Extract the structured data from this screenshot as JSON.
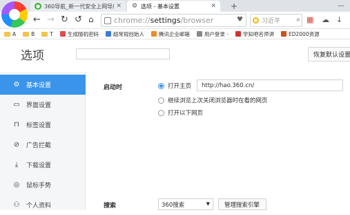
{
  "tabs": [
    {
      "title": "360导航_新一代安全上网导航",
      "active": false
    },
    {
      "title": "选项 - 基本设置",
      "active": true
    }
  ],
  "new_tab_glyph": "+",
  "window_controls": "— ",
  "toolbar": {
    "url_prefix": "chrome://",
    "url_host": "settings",
    "url_path": "/browser",
    "search_placeholder": "习近平"
  },
  "bookmarks": [
    {
      "label": "A",
      "type": "folder"
    },
    {
      "label": "B",
      "type": "folder"
    },
    {
      "label": "T",
      "type": "folder"
    },
    {
      "label": "生成随机密码",
      "type": "link",
      "color": "#e04b4b"
    },
    {
      "label": "超常规创始人",
      "type": "link",
      "color": "#3b7dd8"
    },
    {
      "label": "腾讯企业邮箱",
      "type": "link",
      "color": "#f08a24"
    },
    {
      "label": "用户登录 -",
      "type": "link",
      "color": "#888888"
    },
    {
      "label": "学知吧名师讲",
      "type": "link",
      "color": "#d03535"
    },
    {
      "label": "ED2000资源",
      "type": "link",
      "color": "#c9541a"
    }
  ],
  "page": {
    "title": "选项",
    "reset_label": "恢复默认设置"
  },
  "sidebar": {
    "items": [
      {
        "label": "基本设置",
        "icon": "gear-icon",
        "glyph": "⚙",
        "active": true
      },
      {
        "label": "界面设置",
        "icon": "window-icon",
        "glyph": "▭",
        "active": false
      },
      {
        "label": "标签设置",
        "icon": "tab-icon",
        "glyph": "⊓",
        "active": false
      },
      {
        "label": "广告拦截",
        "icon": "block-icon",
        "glyph": "⊘",
        "active": false
      },
      {
        "label": "下载设置",
        "icon": "download-icon",
        "glyph": "⤓",
        "active": false
      },
      {
        "label": "鼠标手势",
        "icon": "mouse-icon",
        "glyph": "◎",
        "active": false
      },
      {
        "label": "个人资料",
        "icon": "user-icon",
        "glyph": "⚇",
        "active": false
      }
    ]
  },
  "startup": {
    "label": "启动时",
    "options": [
      {
        "label": "打开主页",
        "selected": true
      },
      {
        "label": "继续浏览上次关闭浏览器时在看的网页",
        "selected": false
      },
      {
        "label": "打开以下网页",
        "selected": false
      }
    ],
    "homepage_value": "http://hao.360.cn/"
  },
  "search": {
    "label": "搜索",
    "engine": "360搜索",
    "manage_label": "管理搜索引擎"
  },
  "colors": {
    "accent": "#3a95ea",
    "sidebar_bg": "#f5f6f7"
  }
}
